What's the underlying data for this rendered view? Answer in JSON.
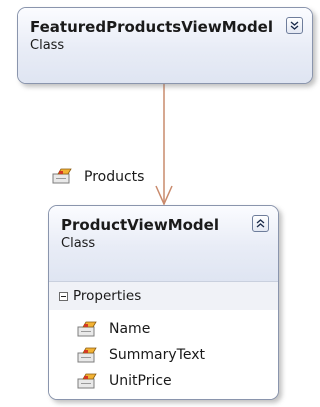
{
  "diagram": {
    "classes": [
      {
        "name": "FeaturedProductsViewModel",
        "kind": "Class",
        "collapse_icon": "double-chevron-down-icon"
      },
      {
        "name": "ProductViewModel",
        "kind": "Class",
        "collapse_icon": "double-chevron-up-icon",
        "compartment": {
          "title": "Properties",
          "members": [
            "Name",
            "SummaryText",
            "UnitPrice"
          ],
          "member_icon": "property-icon"
        }
      }
    ],
    "association": {
      "label": "Products",
      "icon": "property-icon",
      "color": "#c98a6c"
    }
  }
}
